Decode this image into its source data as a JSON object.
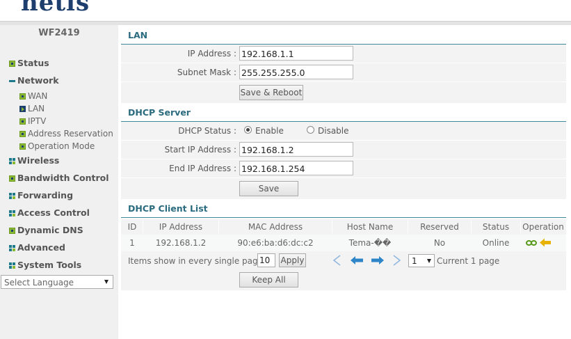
{
  "brand": {
    "logo": "netis"
  },
  "sidebar": {
    "model": "WF2419",
    "menu": [
      {
        "label": "Status",
        "icon": "plus-square-icon"
      },
      {
        "label": "Network",
        "icon": "minus-square-icon"
      },
      {
        "label": "Wireless",
        "icon": "grid-icon"
      },
      {
        "label": "Bandwidth Control",
        "icon": "plus-square-icon"
      },
      {
        "label": "Forwarding",
        "icon": "grid-icon"
      },
      {
        "label": "Access Control",
        "icon": "grid-icon"
      },
      {
        "label": "Dynamic DNS",
        "icon": "plus-square-icon"
      },
      {
        "label": "Advanced",
        "icon": "grid-icon"
      },
      {
        "label": "System Tools",
        "icon": "grid-icon"
      }
    ],
    "network_sub": [
      {
        "label": "WAN"
      },
      {
        "label": "LAN",
        "active": true
      },
      {
        "label": "IPTV"
      },
      {
        "label": "Address Reservation"
      },
      {
        "label": "Operation Mode"
      }
    ],
    "language": "Select Language"
  },
  "lan": {
    "title": "LAN",
    "ip_label": "IP Address :",
    "ip_value": "192.168.1.1",
    "mask_label": "Subnet Mask :",
    "mask_value": "255.255.255.0",
    "save_reboot": "Save & Reboot"
  },
  "dhcp": {
    "title": "DHCP Server",
    "status_label": "DHCP Status :",
    "enable_label": "Enable",
    "disable_label": "Disable",
    "selected": "Enable",
    "start_label": "Start IP Address :",
    "start_value": "192.168.1.2",
    "end_label": "End IP Address :",
    "end_value": "192.168.1.254",
    "save": "Save"
  },
  "client_list": {
    "title": "DHCP Client List",
    "headers": [
      "ID",
      "IP Address",
      "MAC Address",
      "Host Name",
      "Reserved",
      "Status",
      "Operation"
    ],
    "rows": [
      {
        "id": "1",
        "ip": "192.168.1.2",
        "mac": "90:e6:ba:d6:dc:c2",
        "host": "Tema-��",
        "reserved": "No",
        "status": "Online"
      }
    ],
    "per_page_label": "Items show in every single page",
    "per_page_value": "10",
    "apply": "Apply",
    "page_select": "1",
    "current_page": "Current 1 page",
    "keep_all": "Keep All"
  },
  "colors": {
    "accent": "#2b6b7f",
    "brand": "#1e3f6e",
    "green": "#8ab833",
    "arrow_blue": "#2e86c9",
    "arrow_yellow": "#e8b300"
  }
}
